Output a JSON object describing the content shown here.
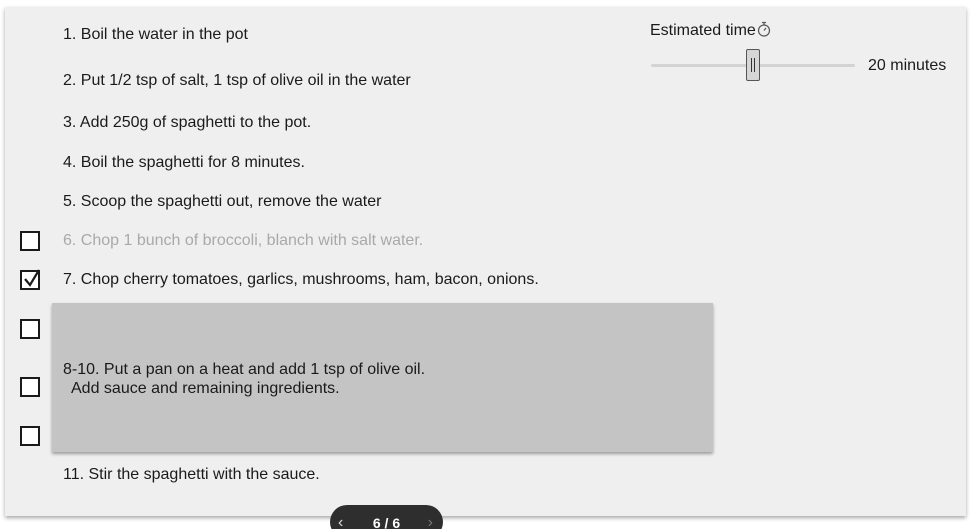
{
  "steps": [
    "1. Boil the water in the pot",
    "2. Put 1/2 tsp of salt, 1 tsp of olive oil in the water",
    "3. Add 250g of spaghetti to the pot.",
    "4. Boil the spaghetti for 8 minutes.",
    "5. Scoop the spaghetti out, remove the water",
    "6. Chop 1 bunch of broccoli, blanch with salt water.",
    "7. Chop cherry tomatoes, garlics, mushrooms, ham, bacon, onions.",
    "8-10. Put a pan on a heat and add 1 tsp of olive oil.\n  Add sauce and remaining ingredients.",
    "11. Stir the spaghetti with the sauce."
  ],
  "checkboxes": {
    "step6_checked": false,
    "step7_checked": true,
    "step8_checked": false,
    "step9_checked": false,
    "step10_checked": false
  },
  "timer": {
    "label": "Estimated time",
    "icon": "stopwatch-icon",
    "value_text": "20 minutes",
    "slider_fraction": 0.5
  },
  "pager": {
    "label": "6 / 6",
    "prev_icon": "chevron-left-icon",
    "next_icon": "chevron-right-icon"
  }
}
